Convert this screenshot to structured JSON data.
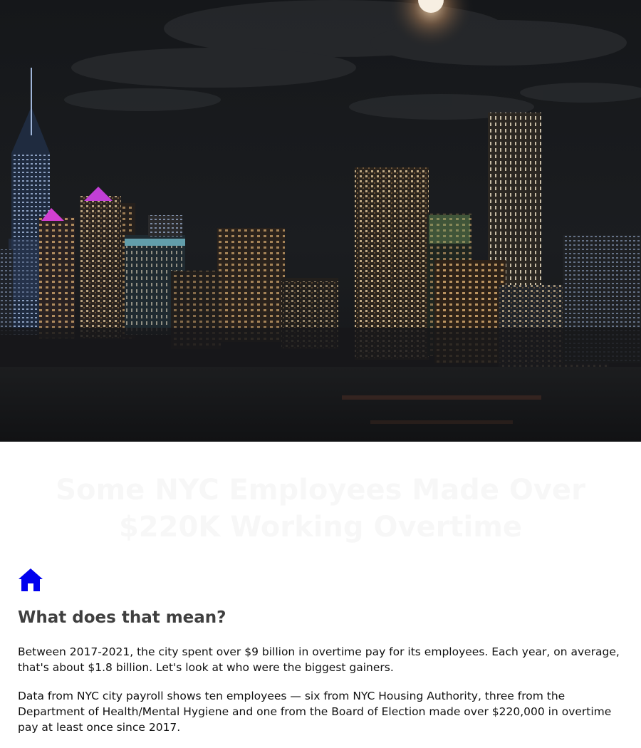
{
  "hero": {
    "image": "nyc-night-skyline-with-full-moon"
  },
  "article": {
    "headline": "Some NYC Employees Made Over $220K Working Overtime",
    "home_icon": "home-icon",
    "section_title": "What does that mean?",
    "paragraphs": [
      "Between 2017-2021, the city spent over $9 billion in overtime pay for its employees. Each year, on average, that's about $1.8 billion. Let's look at who were the biggest gainers.",
      "Data from NYC city payroll shows ten employees — six from NYC Housing Authority, three from the Department of Health/Mental Hygiene and one from the Board of Election made over $220,000 in overtime pay at least once since 2017."
    ]
  },
  "colors": {
    "home_icon": "#0000ee",
    "section_title": "#3f3f3f",
    "body_text": "#111111",
    "headline": "#f7f7f7"
  }
}
